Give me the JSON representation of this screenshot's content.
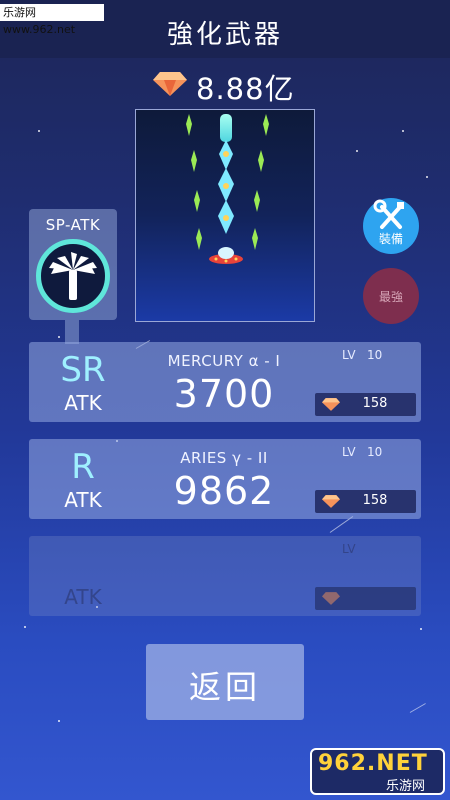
{
  "watermark": "乐游网 www.962.net",
  "header": {
    "title": "強化武器"
  },
  "currency": {
    "icon": "gem-icon",
    "amount": "8.88亿",
    "gem_color": "#f6935b"
  },
  "special": {
    "title": "SP-ATK",
    "icon": "palm-tree-icon",
    "ring_color": "#5fe6da"
  },
  "side_buttons": {
    "equip_label": "裝備",
    "equip_icon": "wrench-screwdriver-icon",
    "strongest_label": "最強"
  },
  "weapons": [
    {
      "rank": "SR",
      "type": "ATK",
      "name": "MERCURY  α - I",
      "value": "3700",
      "lv_label": "LV",
      "lv": "10",
      "cost": "158"
    },
    {
      "rank": "R",
      "type": "ATK",
      "name": "ARIES  γ - II",
      "value": "9862",
      "lv_label": "LV",
      "lv": "10",
      "cost": "158"
    },
    {
      "rank": "",
      "type": "ATK",
      "name": "",
      "value": "",
      "lv_label": "LV",
      "lv": "",
      "cost": ""
    }
  ],
  "back_button": {
    "label": "返回"
  },
  "logo": {
    "main": "962.NET",
    "sub": "乐游网"
  }
}
